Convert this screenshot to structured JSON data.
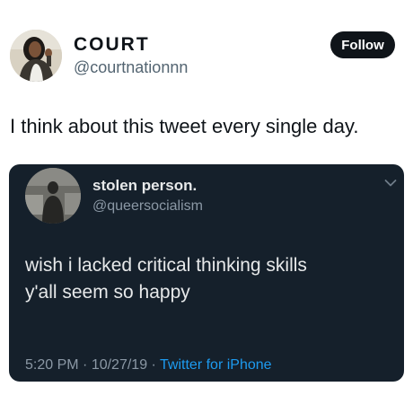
{
  "outer_tweet": {
    "display_name": "COURT",
    "handle": "@courtnationnn",
    "follow_label": "Follow",
    "text": "I think about this tweet every single day."
  },
  "embedded_tweet": {
    "display_name": "stolen person.",
    "handle": "@queersocialism",
    "lines": [
      "wish i lacked critical thinking skills",
      "y'all seem so happy"
    ],
    "time": "5:20 PM",
    "date": "10/27/19",
    "separator": " · ",
    "source": "Twitter for iPhone"
  },
  "icons": {
    "menu": "chevron-down-icon"
  },
  "colors": {
    "follow_bg": "#0f1419",
    "embed_bg": "#15202b",
    "link": "#1d9bf0"
  }
}
